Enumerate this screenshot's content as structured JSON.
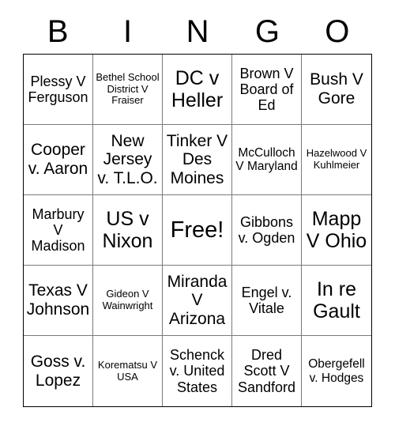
{
  "card": {
    "type": "bingo-card",
    "header_letters": [
      "B",
      "I",
      "N",
      "G",
      "O"
    ],
    "columns": 5,
    "rows": 5,
    "colors": {
      "background": "#ffffff",
      "text": "#000000",
      "outer_border": "#000000",
      "inner_border": "#7a7a7a"
    },
    "free_space": {
      "label": "Free!",
      "row": 3,
      "column": 3
    },
    "cells": [
      {
        "text": "Plessy V Ferguson",
        "size": "fs-m"
      },
      {
        "text": "Bethel School District V Fraiser",
        "size": "fs-xs"
      },
      {
        "text": "DC v Heller",
        "size": "fs-xl"
      },
      {
        "text": "Brown V Board of Ed",
        "size": "fs-m"
      },
      {
        "text": "Bush V Gore",
        "size": "fs-l"
      },
      {
        "text": "Cooper v. Aaron",
        "size": "fs-l"
      },
      {
        "text": "New Jersey v. T.L.O.",
        "size": "fs-l"
      },
      {
        "text": "Tinker V Des Moines",
        "size": "fs-l"
      },
      {
        "text": "McCulloch V Maryland",
        "size": "fs-s"
      },
      {
        "text": "Hazelwood V Kuhlmeier",
        "size": "fs-xs"
      },
      {
        "text": "Marbury V Madison",
        "size": "fs-m"
      },
      {
        "text": "US v Nixon",
        "size": "fs-xl"
      },
      {
        "text": "Free!",
        "size": "fs-xxl"
      },
      {
        "text": "Gibbons v. Ogden",
        "size": "fs-m"
      },
      {
        "text": "Mapp V Ohio",
        "size": "fs-xl"
      },
      {
        "text": "Texas V Johnson",
        "size": "fs-l"
      },
      {
        "text": "Gideon V Wainwright",
        "size": "fs-xs"
      },
      {
        "text": "Miranda V Arizona",
        "size": "fs-l"
      },
      {
        "text": "Engel v. Vitale",
        "size": "fs-m"
      },
      {
        "text": "In re Gault",
        "size": "fs-xl"
      },
      {
        "text": "Goss v. Lopez",
        "size": "fs-l"
      },
      {
        "text": "Korematsu V USA",
        "size": "fs-xs"
      },
      {
        "text": "Schenck v. United States",
        "size": "fs-m"
      },
      {
        "text": "Dred Scott V Sandford",
        "size": "fs-m"
      },
      {
        "text": "Obergefell v. Hodges",
        "size": "fs-s"
      }
    ]
  }
}
